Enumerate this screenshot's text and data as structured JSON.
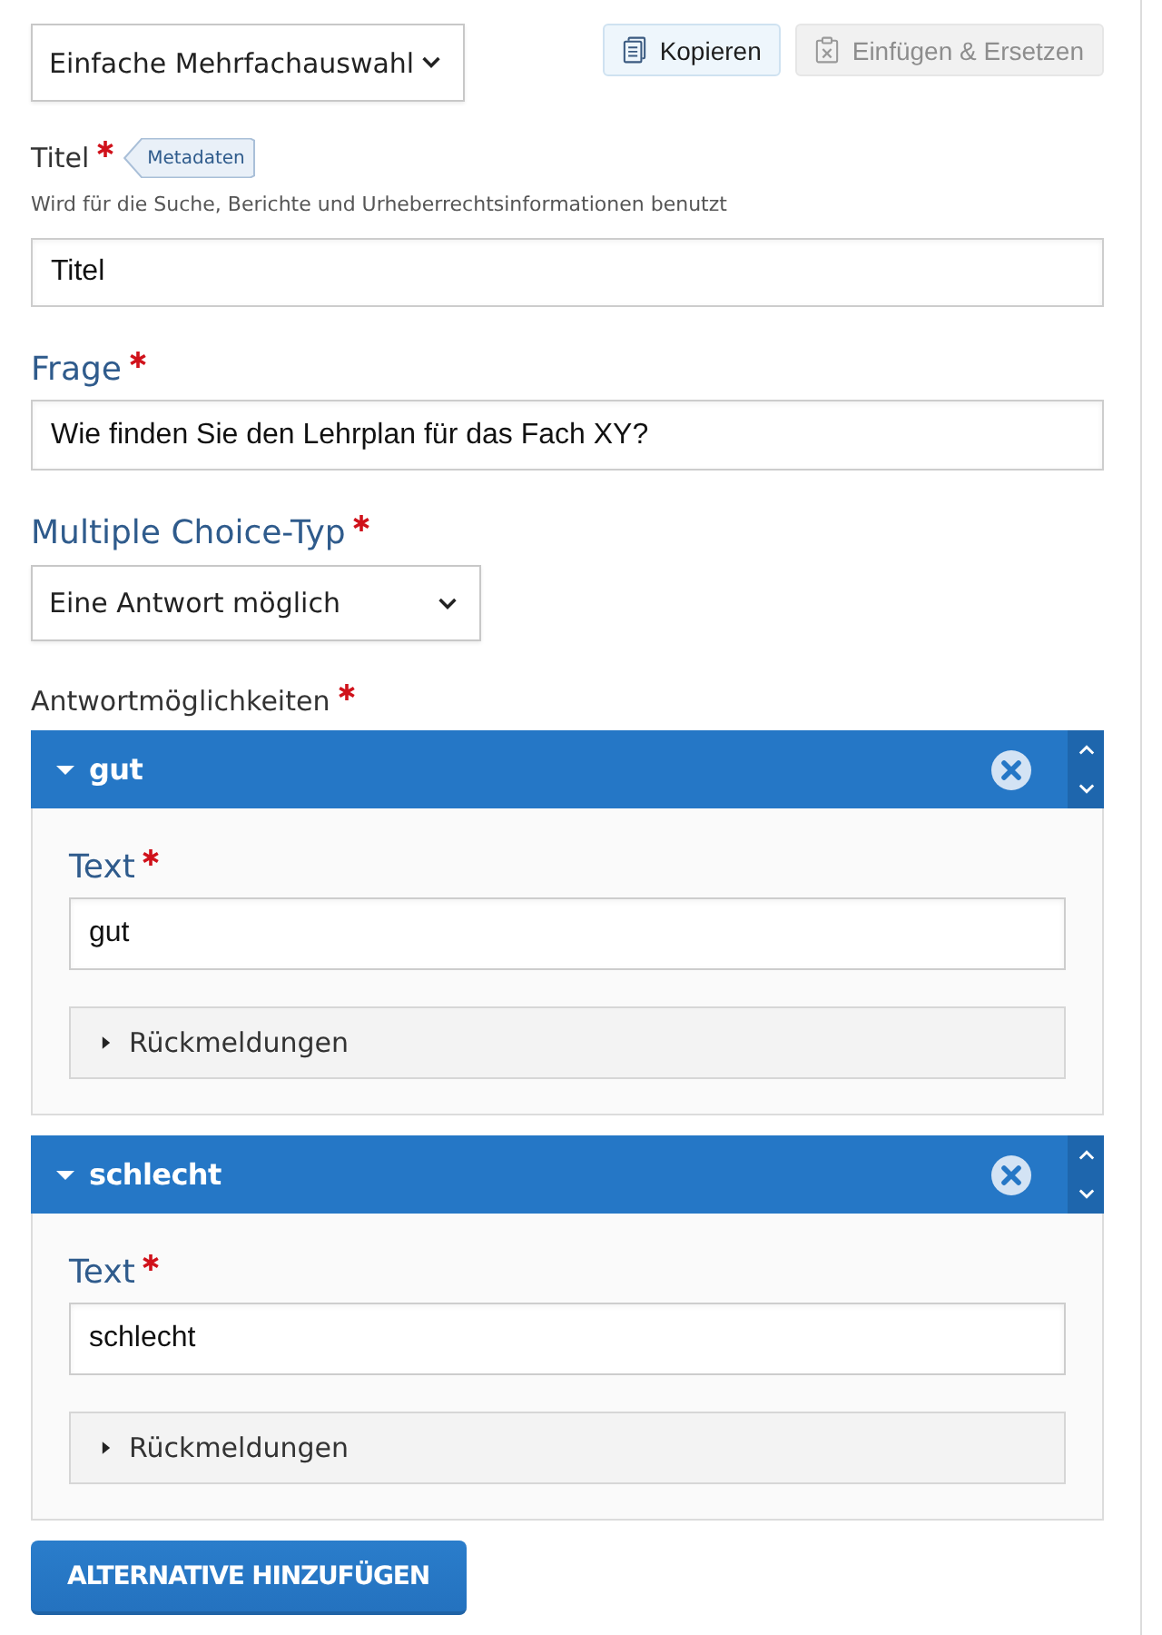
{
  "type_select": {
    "value": "Einfache Mehrfachauswahl"
  },
  "toolbar": [
    {
      "kind": "copy",
      "label": "Kopieren",
      "disabled": false
    },
    {
      "kind": "paste",
      "label": "Einfügen & Ersetzen",
      "disabled": true
    }
  ],
  "title_field": {
    "label": "Titel",
    "required": true,
    "badge": "Metadaten",
    "description": "Wird für die Suche, Berichte und Urheberrechtsinformationen benutzt",
    "value": "Titel"
  },
  "question_field": {
    "label": "Frage",
    "required": true,
    "value": "Wie finden Sie den Lehrplan für das Fach XY?"
  },
  "choice_type": {
    "label": "Multiple Choice-Typ",
    "required": true,
    "value": "Eine Antwort möglich"
  },
  "answers": {
    "label": "Antwortmöglichkeiten",
    "required": true,
    "items": [
      {
        "title": "gut",
        "expanded": true,
        "text_label": "Text",
        "text_required": true,
        "text_value": "gut",
        "feedback": {
          "label": "Rückmeldungen",
          "expanded": false
        }
      },
      {
        "title": "schlecht",
        "expanded": true,
        "text_label": "Text",
        "text_required": true,
        "text_value": "schlecht",
        "feedback": {
          "label": "Rückmeldungen",
          "expanded": false
        }
      }
    ]
  },
  "add_button": {
    "label": "ALTERNATIVE HINZUFÜGEN"
  }
}
